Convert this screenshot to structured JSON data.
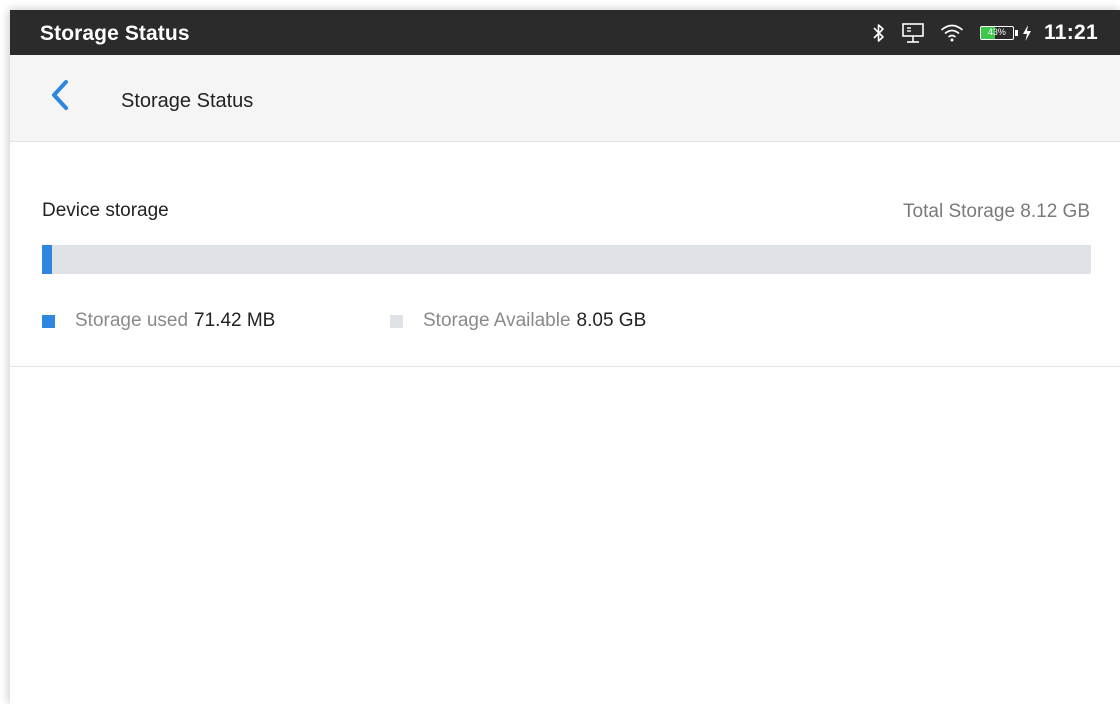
{
  "status_bar": {
    "title": "Storage Status",
    "battery_percent": "43%",
    "battery_level": 0.43,
    "time": "11:21",
    "icons": [
      "bluetooth-icon",
      "ethernet-icon",
      "wifi-icon",
      "battery-icon",
      "charging-icon"
    ]
  },
  "app_bar": {
    "back_icon": "chevron-left-icon",
    "title": "Storage Status"
  },
  "device_storage": {
    "heading": "Device storage",
    "total_label": "Total Storage 8.12 GB",
    "used_fraction": 0.0087,
    "legend": [
      {
        "label": "Storage used",
        "value": "71.42 MB",
        "color": "#2e86de"
      },
      {
        "label": "Storage Available",
        "value": "8.05 GB",
        "color": "#dfe2e6"
      }
    ]
  },
  "colors": {
    "status_bar_bg": "#2b2b2b",
    "app_bar_bg": "#f5f5f5",
    "accent": "#2e86de",
    "battery_fill": "#3cc84b",
    "bar_track": "#dfe2e6"
  }
}
